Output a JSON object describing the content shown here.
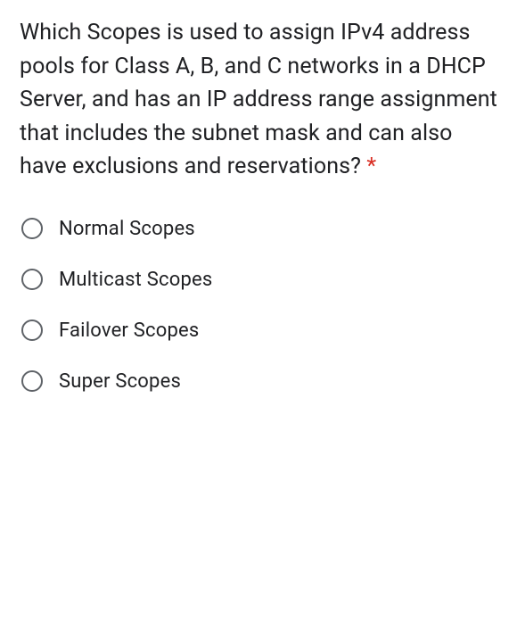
{
  "question": {
    "text": "Which Scopes is used to assign IPv4 address pools for Class A, B, and C networks in a DHCP Server, and has an IP address range assignment that includes the subnet mask and can also have exclusions and reservations?",
    "required_marker": "*"
  },
  "options": [
    {
      "label": "Normal Scopes"
    },
    {
      "label": "Multicast Scopes"
    },
    {
      "label": "Failover Scopes"
    },
    {
      "label": "Super Scopes"
    }
  ]
}
